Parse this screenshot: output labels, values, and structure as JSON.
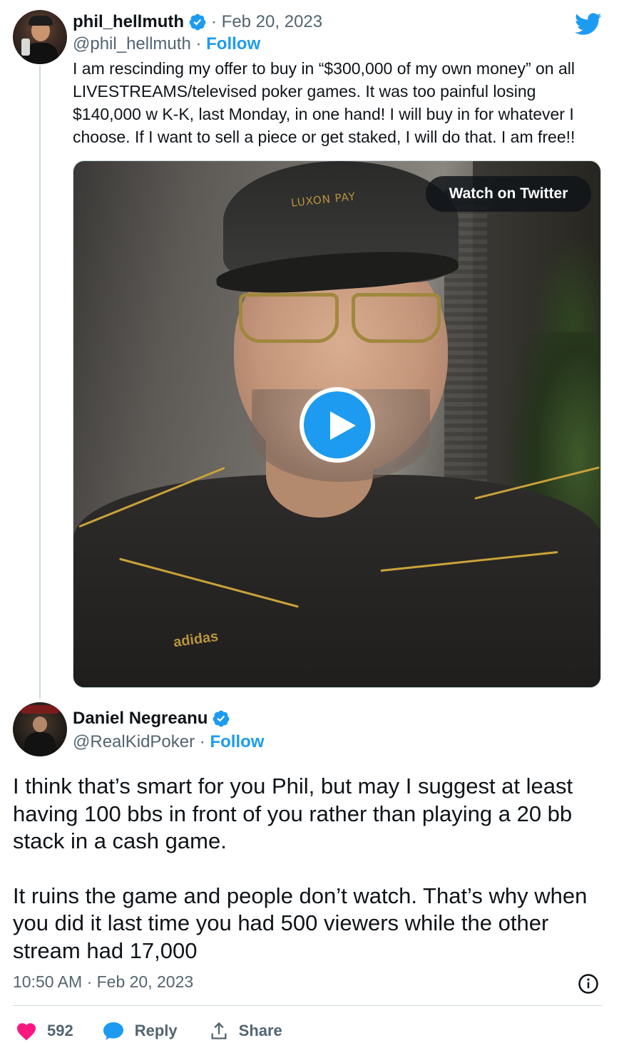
{
  "tweet1": {
    "display_name": "phil_hellmuth",
    "date": "· Feb 20, 2023",
    "handle": "@phil_hellmuth",
    "follow_label": "Follow",
    "separator": "·",
    "text": "I am rescinding my offer to buy in “$300,000 of my own money” on all LIVESTREAMS/televised poker games. It was too painful losing $140,000 w K-K, last Monday, in one hand! I will buy in for whatever I choose. If I want to sell a piece or get staked, I will do that. I am free!!",
    "media": {
      "watch_label": "Watch on Twitter",
      "cap_text": "LUXON PAY",
      "shirt_brand": "adidas"
    }
  },
  "tweet2": {
    "display_name": "Daniel Negreanu",
    "handle": "@RealKidPoker",
    "separator": "·",
    "follow_label": "Follow",
    "paragraph1": "I think that’s smart for you Phil, but may I suggest at least having 100 bbs in front of you rather than playing a 20 bb stack in a cash game.",
    "paragraph2": "It ruins the game and people don’t watch. That’s why when you did it last time you had 500 viewers while the other stream had 17,000",
    "timestamp": "10:50 AM · Feb 20, 2023"
  },
  "actions": {
    "likes": "592",
    "reply_label": "Reply",
    "share_label": "Share"
  },
  "icons": {
    "verified": "verified-badge-icon",
    "twitter": "twitter-bird-icon",
    "play": "play-icon",
    "info": "info-icon",
    "heart": "heart-icon",
    "reply": "reply-bubble-icon",
    "share": "share-icon"
  },
  "colors": {
    "accent": "#1d9bf0",
    "text": "#0f1419",
    "secondary": "#536471",
    "like": "#f91880"
  }
}
